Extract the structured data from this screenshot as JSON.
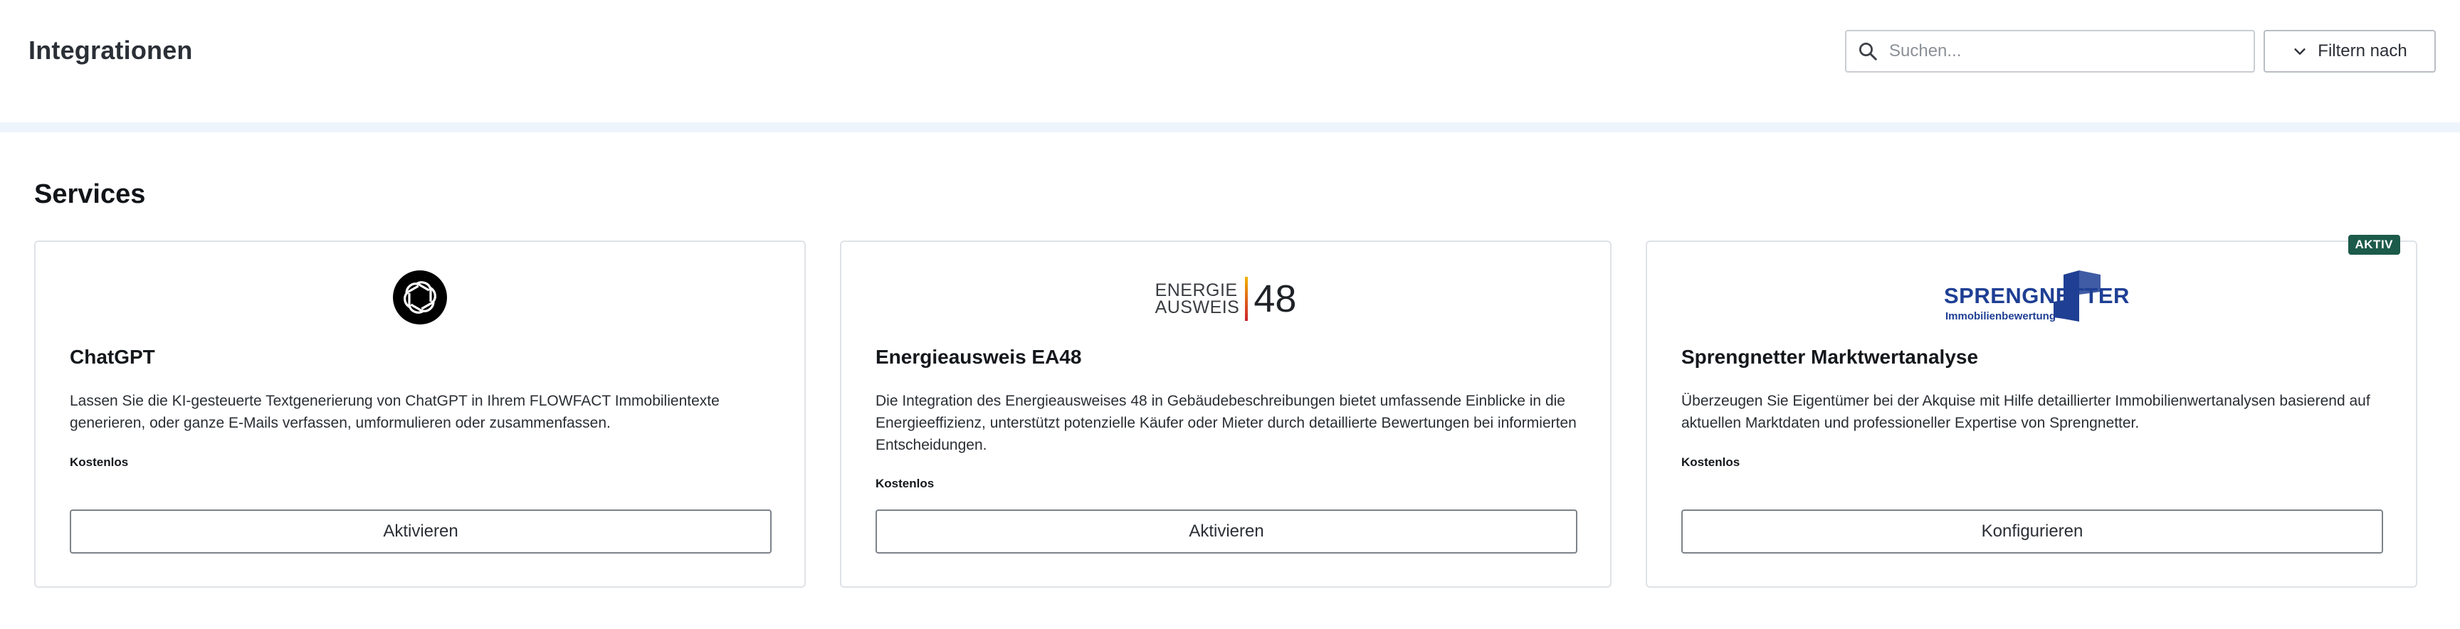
{
  "header": {
    "title": "Integrationen",
    "search_placeholder": "Suchen...",
    "filter_label": "Filtern nach"
  },
  "section": {
    "title": "Services"
  },
  "cards": [
    {
      "title": "ChatGPT",
      "description": "Lassen Sie die KI-gesteuerte Textgenerierung von ChatGPT in Ihrem FLOWFACT Immobilientexte generieren, oder ganze E-Mails verfassen, umformulieren oder zusammenfassen.",
      "price": "Kostenlos",
      "button_label": "Aktivieren",
      "logo_icon": "openai-logo-icon"
    },
    {
      "title": "Energieausweis EA48",
      "description": "Die Integration des Energieausweises 48 in Gebäudebeschreibungen bietet umfassende Einblicke in die Energieeffizienz, unterstützt potenzielle Käufer oder Mieter durch detaillierte Bewertungen bei informierten Entscheidungen.",
      "price": "Kostenlos",
      "button_label": "Aktivieren",
      "logo": {
        "line1": "ENERGIE",
        "line2": "AUSWEIS",
        "number": "48"
      }
    },
    {
      "title": "Sprengnetter Marktwertanalyse",
      "description": "Überzeugen Sie Eigentümer bei der Akquise mit Hilfe detaillierter Immobilienwertanalysen basierend auf aktuellen Marktdaten und professioneller Expertise von Sprengnetter.",
      "price": "Kostenlos",
      "button_label": "Konfigurieren",
      "badge": "AKTIV",
      "logo": {
        "name": "SPRENGNETTER",
        "sub": "Immobilienbewertung"
      }
    }
  ],
  "colors": {
    "badge_bg": "#1c5a49",
    "sprengnetter_blue": "#1f3f94",
    "band": "#eef4fb"
  }
}
